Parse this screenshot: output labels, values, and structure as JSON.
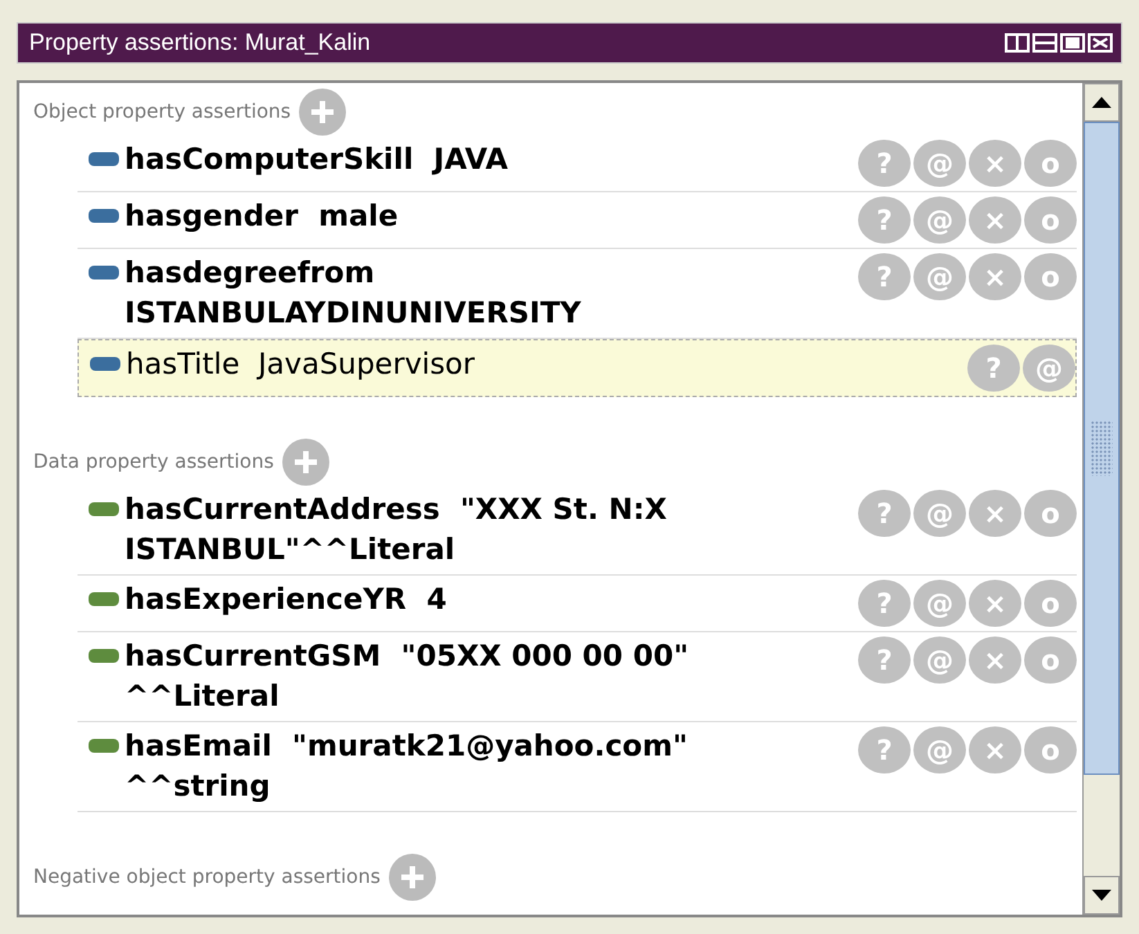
{
  "window": {
    "title": "Property assertions: Murat_Kalin"
  },
  "sections": [
    {
      "kind": "object",
      "heading": "Object property assertions",
      "rows": [
        {
          "property": "hasComputerSkill",
          "value": "JAVA",
          "selected": false,
          "actions": [
            "?",
            "@",
            "×",
            "o"
          ]
        },
        {
          "property": "hasgender",
          "value": "male",
          "selected": false,
          "actions": [
            "?",
            "@",
            "×",
            "o"
          ]
        },
        {
          "property": "hasdegreefrom",
          "value": "ISTANBULAYDINUNIVERSITY",
          "selected": false,
          "actions": [
            "?",
            "@",
            "×",
            "o"
          ]
        },
        {
          "property": "hasTitle",
          "value": "JavaSupervisor",
          "selected": true,
          "actions": [
            "?",
            "@"
          ]
        }
      ]
    },
    {
      "kind": "data",
      "heading": "Data property assertions",
      "rows": [
        {
          "property": "hasCurrentAddress",
          "value": "\"XXX St. N:X ISTANBUL\"^^Literal",
          "selected": false,
          "actions": [
            "?",
            "@",
            "×",
            "o"
          ]
        },
        {
          "property": "hasExperienceYR",
          "value": "4",
          "selected": false,
          "actions": [
            "?",
            "@",
            "×",
            "o"
          ]
        },
        {
          "property": "hasCurrentGSM",
          "value": "\"05XX 000 00 00\" ^^Literal",
          "selected": false,
          "actions": [
            "?",
            "@",
            "×",
            "o"
          ]
        },
        {
          "property": "hasEmail",
          "value": "\"muratk21@yahoo.com\" ^^string",
          "selected": false,
          "actions": [
            "?",
            "@",
            "×",
            "o"
          ]
        }
      ]
    },
    {
      "heading": "Negative object property assertions"
    }
  ]
}
